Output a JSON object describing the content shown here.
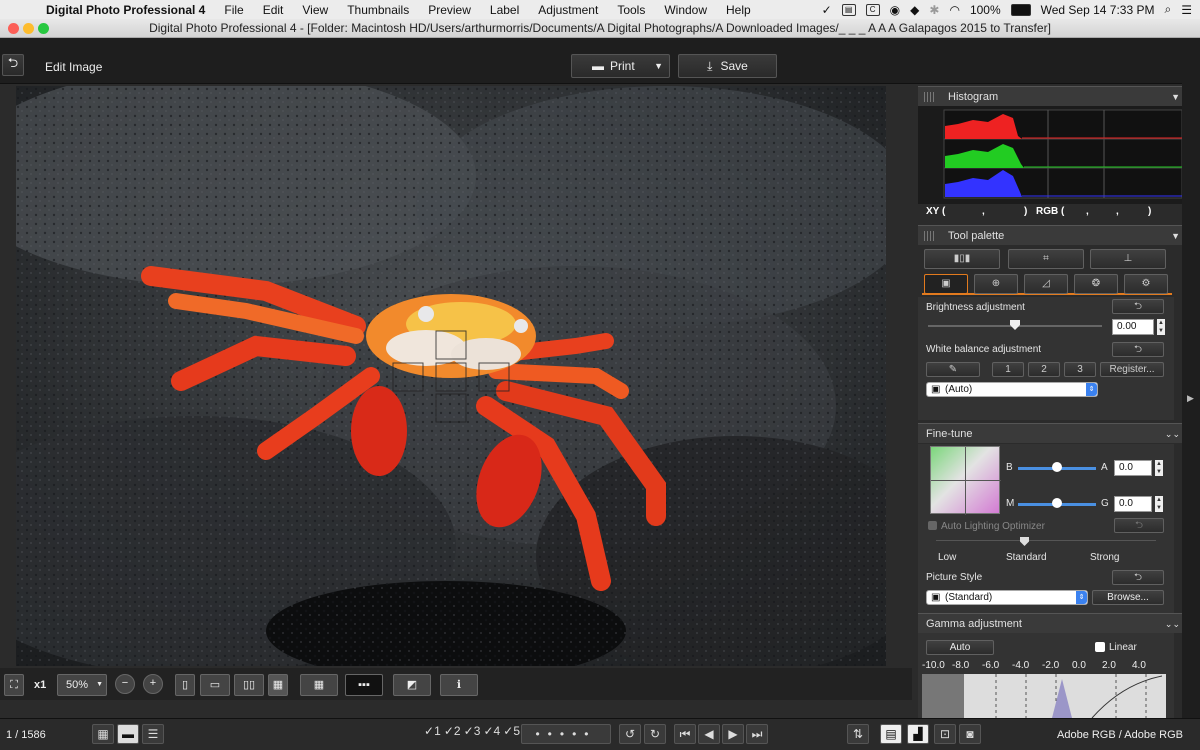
{
  "menubar": {
    "app": "Digital Photo Professional 4",
    "items": [
      "File",
      "Edit",
      "View",
      "Thumbnails",
      "Preview",
      "Label",
      "Adjustment",
      "Tools",
      "Window",
      "Help"
    ],
    "battery": "100%",
    "datetime": "Wed Sep 14  7:33 PM"
  },
  "window": {
    "title": "Digital Photo Professional 4 - [Folder: Macintosh HD/Users/arthurmorris/Documents/A Digital Photographs/A Downloaded Images/_ _ _ A A A Galapagos 2015 to Transfer]"
  },
  "toolbar": {
    "mode_label": "Edit Image",
    "print_label": "Print",
    "save_label": "Save"
  },
  "histogram": {
    "title": "Histogram",
    "xy_label": "XY (",
    "xy_sep": ",",
    "xy_close": ")",
    "rgb_label": "RGB (",
    "rgb_sep1": ",",
    "rgb_sep2": ",",
    "rgb_close": ")"
  },
  "tool_palette": {
    "title": "Tool palette",
    "brightness_label": "Brightness adjustment",
    "brightness_value": "0.00",
    "brightness_level": 0.5,
    "wb_label": "White balance adjustment",
    "wb_presets": [
      "1",
      "2",
      "3"
    ],
    "wb_register": "Register...",
    "wb_select": "(Auto)"
  },
  "finetune": {
    "title": "Fine-tune",
    "b_label": "B",
    "a_label": "A",
    "a_value": "0.0",
    "m_label": "M",
    "g_label": "G",
    "g_value": "0.0",
    "alo_label": "Auto Lighting Optimizer",
    "alo_low": "Low",
    "alo_standard": "Standard",
    "alo_strong": "Strong",
    "ps_label": "Picture Style",
    "ps_select": "(Standard)",
    "ps_browse": "Browse..."
  },
  "gamma": {
    "title": "Gamma adjustment",
    "auto_label": "Auto",
    "linear_label": "Linear",
    "ticks": [
      "-10.0",
      "-8.0",
      "-6.0",
      "-4.0",
      "-2.0",
      "0.0",
      "2.0",
      "4.0"
    ]
  },
  "image_toolbar": {
    "zoom_x1": "x1",
    "zoom_value": "50%"
  },
  "statusbar": {
    "counter": "1 / 1586",
    "colorspace": "Adobe RGB / Adobe RGB",
    "ratings": [
      "1",
      "2",
      "3",
      "4",
      "5"
    ]
  }
}
